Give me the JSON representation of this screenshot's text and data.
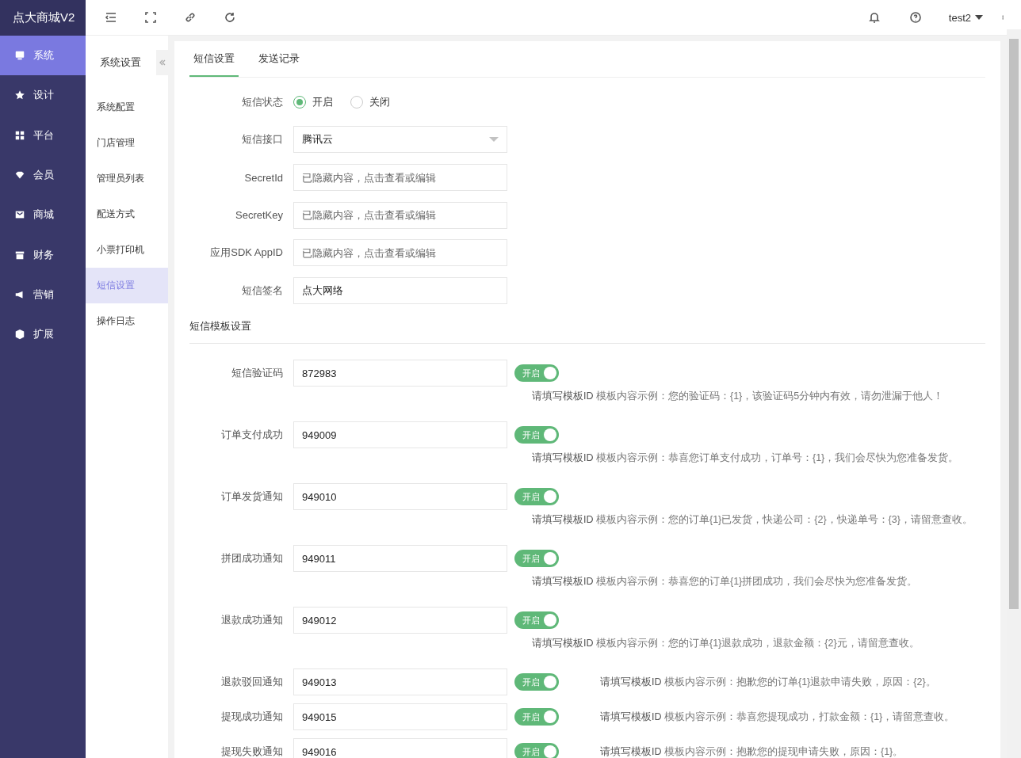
{
  "brand": "点大商城V2",
  "main_nav": [
    {
      "label": "系统",
      "selected": true
    },
    {
      "label": "设计",
      "selected": false
    },
    {
      "label": "平台",
      "selected": false
    },
    {
      "label": "会员",
      "selected": false
    },
    {
      "label": "商城",
      "selected": false
    },
    {
      "label": "财务",
      "selected": false
    },
    {
      "label": "营销",
      "selected": false
    },
    {
      "label": "扩展",
      "selected": false
    }
  ],
  "header": {
    "user": "test2"
  },
  "sub_nav": {
    "title": "系统设置",
    "items": [
      {
        "label": "系统配置",
        "selected": false
      },
      {
        "label": "门店管理",
        "selected": false
      },
      {
        "label": "管理员列表",
        "selected": false
      },
      {
        "label": "配送方式",
        "selected": false
      },
      {
        "label": "小票打印机",
        "selected": false
      },
      {
        "label": "短信设置",
        "selected": true
      },
      {
        "label": "操作日志",
        "selected": false
      }
    ]
  },
  "tabs": [
    {
      "label": "短信设置",
      "selected": true
    },
    {
      "label": "发送记录",
      "selected": false
    }
  ],
  "form": [
    {
      "kind": "radio",
      "label": "短信状态",
      "options": [
        {
          "label": "开启",
          "selected": true
        },
        {
          "label": "关闭",
          "selected": false
        }
      ]
    },
    {
      "kind": "select",
      "label": "短信接口",
      "value": "腾讯云"
    },
    {
      "kind": "input",
      "label": "SecretId",
      "placeholder": "已隐藏内容，点击查看或编辑"
    },
    {
      "kind": "input",
      "label": "SecretKey",
      "placeholder": "已隐藏内容，点击查看或编辑"
    },
    {
      "kind": "input",
      "label": "应用SDK AppID",
      "placeholder": "已隐藏内容，点击查看或编辑"
    },
    {
      "kind": "input",
      "label": "短信签名",
      "value": "点大网络"
    }
  ],
  "template_section": "短信模板设置",
  "templates": [
    {
      "kind": "stacked",
      "label": "短信验证码",
      "value": "872983",
      "toggle": {
        "label": "开启",
        "on": true
      },
      "hint": "**请填写模板ID** 模板内容示例：您的验证码：{1}，该验证码5分钟内有效，请勿泄漏于他人！"
    },
    {
      "kind": "stacked",
      "label": "订单支付成功",
      "value": "949009",
      "toggle": {
        "label": "开启",
        "on": true
      },
      "hint": "**请填写模板ID** 模板内容示例：恭喜您订单支付成功，订单号：{1}，我们会尽快为您准备发货。"
    },
    {
      "kind": "stacked",
      "label": "订单发货通知",
      "value": "949010",
      "toggle": {
        "label": "开启",
        "on": true
      },
      "hint": "**请填写模板ID** 模板内容示例：您的订单{1}已发货，快递公司：{2}，快递单号：{3}，请留意查收。"
    },
    {
      "kind": "stacked",
      "label": "拼团成功通知",
      "value": "949011",
      "toggle": {
        "label": "开启",
        "on": true
      },
      "hint": "**请填写模板ID** 模板内容示例：恭喜您的订单{1}拼团成功，我们会尽快为您准备发货。"
    },
    {
      "kind": "stacked",
      "label": "退款成功通知",
      "value": "949012",
      "toggle": {
        "label": "开启",
        "on": true
      },
      "hint": "**请填写模板ID** 模板内容示例：您的订单{1}退款成功，退款金额：{2}元，请留意查收。"
    },
    {
      "kind": "inline",
      "label": "退款驳回通知",
      "value": "949013",
      "toggle": {
        "label": "开启",
        "on": true
      },
      "hint": "**请填写模板ID** 模板内容示例：抱歉您的订单{1}退款申请失败，原因：{2}。"
    },
    {
      "kind": "inline",
      "label": "提现成功通知",
      "value": "949015",
      "toggle": {
        "label": "开启",
        "on": true
      },
      "hint": "**请填写模板ID** 模板内容示例：恭喜您提现成功，打款金额：{1}，请留意查收。"
    },
    {
      "kind": "inline",
      "label": "提现失败通知",
      "value": "949016",
      "toggle": {
        "label": "开启",
        "on": true
      },
      "hint": "**请填写模板ID** 模板内容示例：抱歉您的提现申请失败，原因：{1}。"
    }
  ]
}
